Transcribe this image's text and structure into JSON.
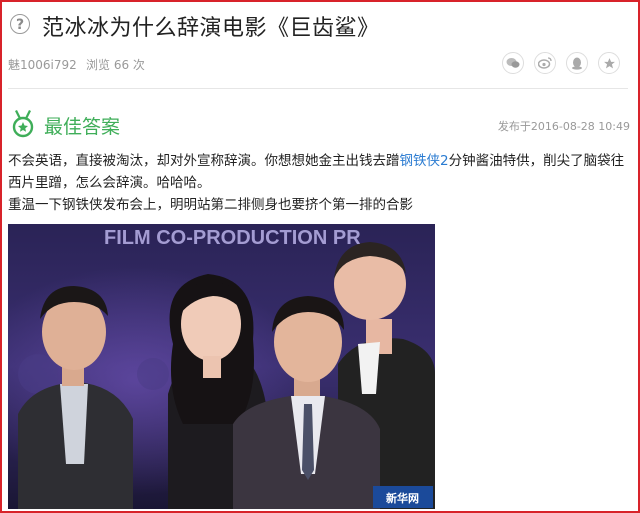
{
  "question": {
    "title": "范冰冰为什么辞演电影《巨齿鲨》",
    "user": "魅1006i792",
    "views": "浏览 66 次"
  },
  "share_icons": [
    "wechat-icon",
    "weibo-icon",
    "qq-icon",
    "star-icon"
  ],
  "best_answer": {
    "label": "最佳答案",
    "posted": "发布于2016-08-28 10:49",
    "line1_pre": "不会英语，直接被淘汰，却对外宣称辞演。你想想她金主出钱去蹭",
    "line1_link": "钢铁侠2",
    "line1_post": "分钟酱油特供，削尖了脑袋往西片里蹭，怎么会辞演。哈哈哈。",
    "line2": "重温一下钢铁侠发布会上，明明站第二排侧身也要挤个第一排的合影"
  },
  "photo": {
    "banner_text": "FILM CO-PRODUCTION PR",
    "watermark": "新华网"
  },
  "colors": {
    "frame": "#d8232a",
    "accent_green": "#3fae59",
    "link_blue": "#2a7bd1"
  }
}
